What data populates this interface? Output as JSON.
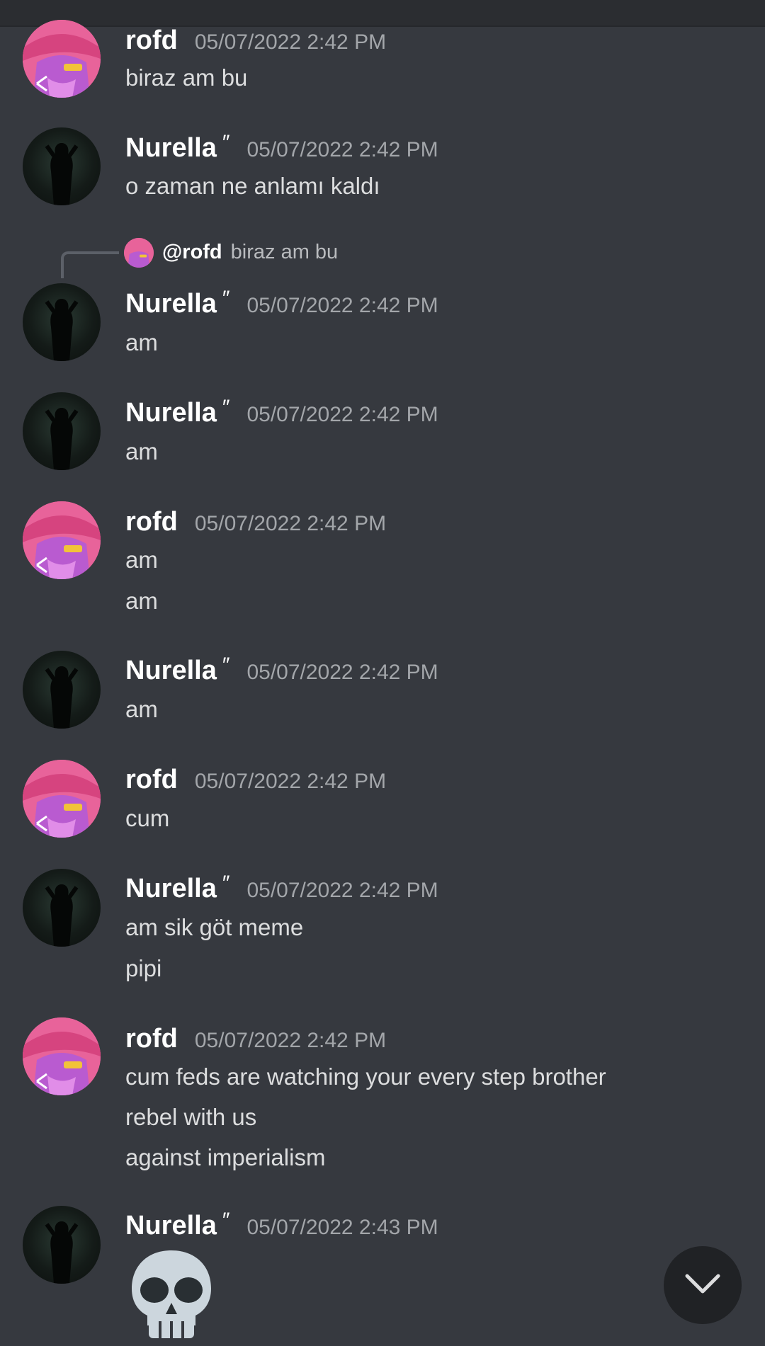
{
  "messages": [
    {
      "user": "rofd",
      "badge": "",
      "time": "05/07/2022 2:42 PM",
      "lines": [
        "biraz am bu"
      ]
    },
    {
      "user": "Nurella",
      "badge": "″",
      "time": "05/07/2022 2:42 PM",
      "lines": [
        "o zaman ne anlamı kaldı"
      ]
    },
    {
      "user": "Nurella",
      "badge": "″",
      "time": "05/07/2022 2:42 PM",
      "lines": [
        "am"
      ],
      "reply": {
        "user": "@rofd",
        "text": "biraz am bu"
      }
    },
    {
      "user": "Nurella",
      "badge": "″",
      "time": "05/07/2022 2:42 PM",
      "lines": [
        "am"
      ]
    },
    {
      "user": "rofd",
      "badge": "",
      "time": "05/07/2022 2:42 PM",
      "lines": [
        "am",
        "am"
      ]
    },
    {
      "user": "Nurella",
      "badge": "″",
      "time": "05/07/2022 2:42 PM",
      "lines": [
        "am"
      ]
    },
    {
      "user": "rofd",
      "badge": "",
      "time": "05/07/2022 2:42 PM",
      "lines": [
        "cum"
      ]
    },
    {
      "user": "Nurella",
      "badge": "″",
      "time": "05/07/2022 2:42 PM",
      "lines": [
        "am sik göt meme",
        "pipi"
      ]
    },
    {
      "user": "rofd",
      "badge": "",
      "time": "05/07/2022 2:42 PM",
      "lines": [
        "cum feds are watching your every step brother",
        "rebel with us",
        "against imperialism"
      ]
    },
    {
      "user": "Nurella",
      "badge": "″",
      "time": "05/07/2022 2:43 PM",
      "lines": [],
      "emoji": "skull-emoji"
    }
  ],
  "jump_to_present_icon": "chevron-down-icon",
  "colors": {
    "background": "#36393f",
    "username": "#ffffff",
    "timestamp": "#a3a6aa",
    "text": "#dcddde",
    "rofd_avatar": "#e8639a"
  }
}
